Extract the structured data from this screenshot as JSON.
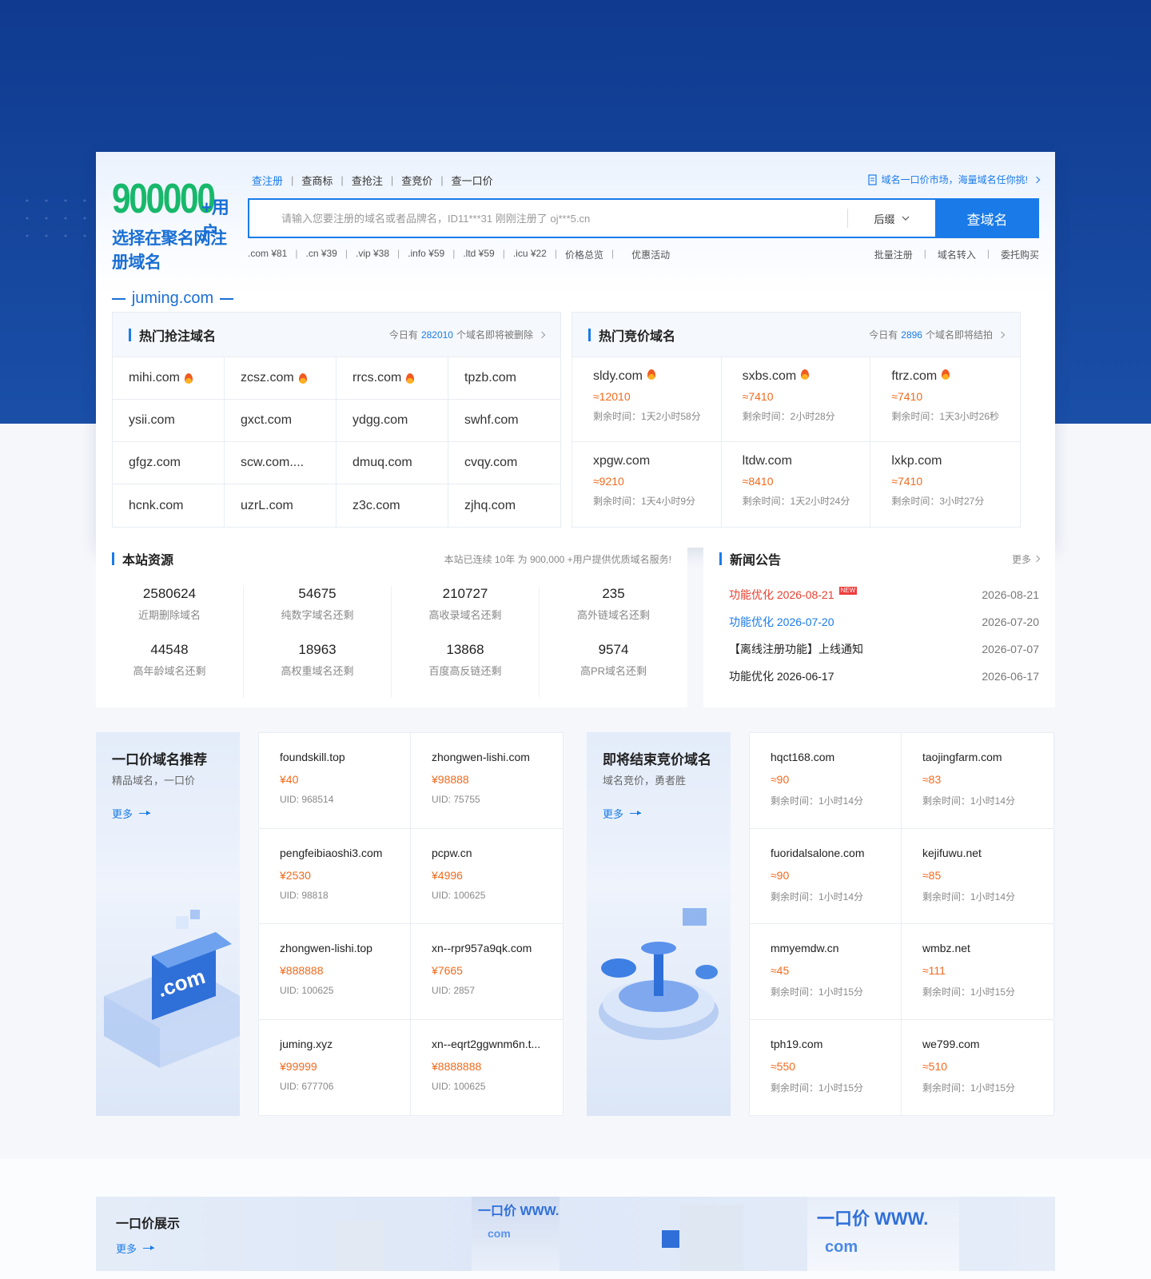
{
  "logo": {
    "number": "900000",
    "suffix": "+用户",
    "line2": "选择在聚名网注册域名",
    "line3": "juming.com"
  },
  "search": {
    "tabs": [
      "查注册",
      "查商标",
      "查抢注",
      "查竞价",
      "查一口价"
    ],
    "promo": "域名一口价市场，海量域名任你挑!",
    "placeholder": "请输入您要注册的域名或者品牌名，ID11***31 刚刚注册了 oj***5.cn",
    "suffix_label": "后缀",
    "button": "查域名",
    "prices": [
      ".com ¥81",
      ".cn ¥39",
      ".vip ¥38",
      ".info ¥59",
      ".ltd ¥59",
      ".icu ¥22",
      "价格总览",
      "优惠活动"
    ],
    "right_links": [
      "批量注册",
      "域名转入",
      "委托购买"
    ]
  },
  "hot_grab": {
    "title": "热门抢注域名",
    "note_prefix": "今日有",
    "count": "282010",
    "note_suffix": "个域名即将被删除",
    "items": [
      {
        "name": "mihi.com",
        "hot": true
      },
      {
        "name": "zcsz.com",
        "hot": true
      },
      {
        "name": "rrcs.com",
        "hot": true
      },
      {
        "name": "tpzb.com",
        "hot": false
      },
      {
        "name": "ysii.com",
        "hot": false
      },
      {
        "name": "gxct.com",
        "hot": false
      },
      {
        "name": "ydgg.com",
        "hot": false
      },
      {
        "name": "swhf.com",
        "hot": false
      },
      {
        "name": "gfgz.com",
        "hot": false
      },
      {
        "name": "scw.com....",
        "hot": false
      },
      {
        "name": "dmuq.com",
        "hot": false
      },
      {
        "name": "cvqy.com",
        "hot": false
      },
      {
        "name": "hcnk.com",
        "hot": false
      },
      {
        "name": "uzrL.com",
        "hot": false
      },
      {
        "name": "z3c.com",
        "hot": false
      },
      {
        "name": "zjhq.com",
        "hot": false
      }
    ]
  },
  "hot_bid": {
    "title": "热门竞价域名",
    "note_prefix": "今日有",
    "count": "2896",
    "note_suffix": "个域名即将结拍",
    "items": [
      {
        "name": "sldy.com",
        "hot": true,
        "price": "≈12010",
        "time": "剩余时间：1天2小时58分"
      },
      {
        "name": "sxbs.com",
        "hot": true,
        "price": "≈7410",
        "time": "剩余时间：2小时28分"
      },
      {
        "name": "ftrz.com",
        "hot": true,
        "price": "≈7410",
        "time": "剩余时间：1天3小时26秒"
      },
      {
        "name": "xpgw.com",
        "hot": false,
        "price": "≈9210",
        "time": "剩余时间：1天4小时9分"
      },
      {
        "name": "ltdw.com",
        "hot": false,
        "price": "≈8410",
        "time": "剩余时间：1天2小时24分"
      },
      {
        "name": "lxkp.com",
        "hot": false,
        "price": "≈7410",
        "time": "剩余时间：3小时27分"
      }
    ]
  },
  "resources": {
    "title": "本站资源",
    "note": "本站已连续 10年 为 900,000 +用户提供优质域名服务!",
    "items": [
      {
        "value": "2580624",
        "label": "近期删除域名"
      },
      {
        "value": "54675",
        "label": "纯数字域名还剩"
      },
      {
        "value": "210727",
        "label": "高收录域名还剩"
      },
      {
        "value": "235",
        "label": "高外链域名还剩"
      },
      {
        "value": "44548",
        "label": "高年龄域名还剩"
      },
      {
        "value": "18963",
        "label": "高权重域名还剩"
      },
      {
        "value": "13868",
        "label": "百度高反链还剩"
      },
      {
        "value": "9574",
        "label": "高PR域名还剩"
      }
    ]
  },
  "news": {
    "title": "新闻公告",
    "more": "更多",
    "items": [
      {
        "title": "功能优化 2026-08-21",
        "date": "2026-08-21",
        "color": "#e8402f",
        "new": "NEW"
      },
      {
        "title": "功能优化 2026-07-20",
        "date": "2026-07-20",
        "color": "#1a7be8",
        "new": ""
      },
      {
        "title": "【离线注册功能】上线通知",
        "date": "2026-07-07",
        "color": "#222",
        "new": ""
      },
      {
        "title": "功能优化 2026-06-17",
        "date": "2026-06-17",
        "color": "#222",
        "new": ""
      }
    ]
  },
  "fixed_price": {
    "title": "一口价域名推荐",
    "subtitle": "精品域名，一口价",
    "more": "更多",
    "items": [
      {
        "name": "foundskill.top",
        "price": "¥40",
        "uid": "UID: 968514"
      },
      {
        "name": "zhongwen-lishi.com",
        "price": "¥98888",
        "uid": "UID: 75755"
      },
      {
        "name": "pengfeibiaoshi3.com",
        "price": "¥2530",
        "uid": "UID: 98818"
      },
      {
        "name": "pcpw.cn",
        "price": "¥4996",
        "uid": "UID: 100625"
      },
      {
        "name": "zhongwen-lishi.top",
        "price": "¥888888",
        "uid": "UID: 100625"
      },
      {
        "name": "xn--rpr957a9qk.com",
        "price": "¥7665",
        "uid": "UID: 2857"
      },
      {
        "name": "juming.xyz",
        "price": "¥99999",
        "uid": "UID: 677706"
      },
      {
        "name": "xn--eqrt2ggwnm6n.t...",
        "price": "¥8888888",
        "uid": "UID: 100625"
      }
    ]
  },
  "ending_bid": {
    "title": "即将结束竞价域名",
    "subtitle": "域名竞价，勇者胜",
    "more": "更多",
    "items": [
      {
        "name": "hqct168.com",
        "price": "≈90",
        "time": "剩余时间：1小时14分"
      },
      {
        "name": "taojingfarm.com",
        "price": "≈83",
        "time": "剩余时间：1小时14分"
      },
      {
        "name": "fuoridalsalone.com",
        "price": "≈90",
        "time": "剩余时间：1小时14分"
      },
      {
        "name": "kejifuwu.net",
        "price": "≈85",
        "time": "剩余时间：1小时14分"
      },
      {
        "name": "mmyemdw.cn",
        "price": "≈45",
        "time": "剩余时间：1小时15分"
      },
      {
        "name": "wmbz.net",
        "price": "≈111",
        "time": "剩余时间：1小时15分"
      },
      {
        "name": "tph19.com",
        "price": "≈550",
        "time": "剩余时间：1小时15分"
      },
      {
        "name": "we799.com",
        "price": "≈510",
        "time": "剩余时间：1小时15分"
      }
    ]
  },
  "showcase": {
    "title": "一口价展示",
    "more": "更多",
    "banner1": "一口价 WWW.",
    "banner1b": "com",
    "banner2": "一口价 WWW.",
    "banner2b": "com"
  }
}
